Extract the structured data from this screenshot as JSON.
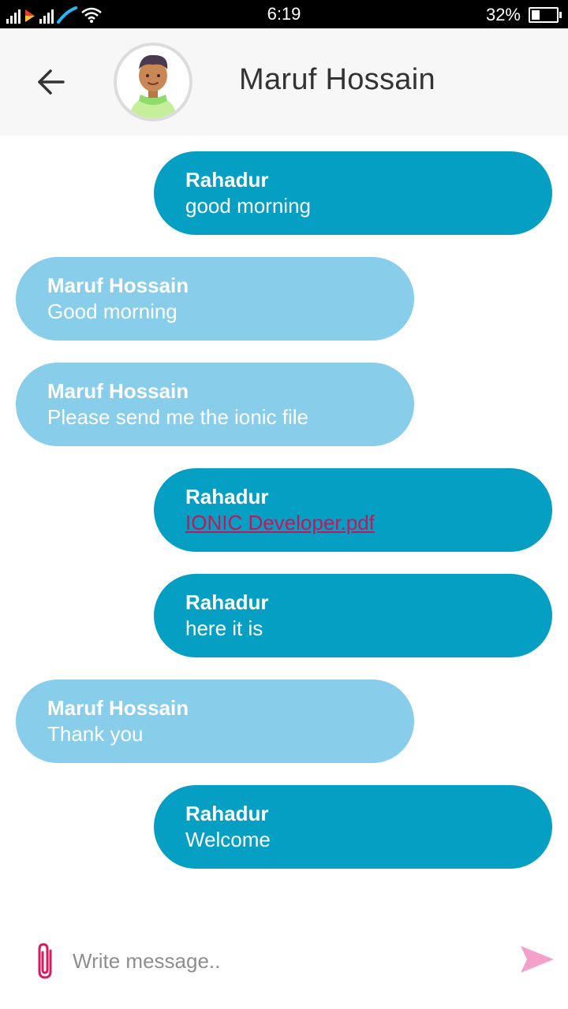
{
  "status_bar": {
    "time": "6:19",
    "battery_percent": "32%",
    "battery_level": 0.32
  },
  "header": {
    "title": "Maruf Hossain",
    "back_icon": "arrow-left-icon",
    "avatar_icon": "user-avatar"
  },
  "messages": [
    {
      "side": "me",
      "sender": "Rahadur",
      "text": "good morning",
      "is_link": false
    },
    {
      "side": "them",
      "sender": "Maruf Hossain",
      "text": "Good morning",
      "is_link": false
    },
    {
      "side": "them",
      "sender": "Maruf Hossain",
      "text": "Please send me the ionic file",
      "is_link": false
    },
    {
      "side": "me",
      "sender": "Rahadur",
      "text": "IONIC Developer.pdf",
      "is_link": true
    },
    {
      "side": "me",
      "sender": "Rahadur",
      "text": "here it is",
      "is_link": false
    },
    {
      "side": "them",
      "sender": "Maruf Hossain",
      "text": "Thank you",
      "is_link": false
    },
    {
      "side": "me",
      "sender": "Rahadur",
      "text": "Welcome",
      "is_link": false
    }
  ],
  "composer": {
    "placeholder": "Write message..",
    "value": "",
    "attach_icon": "paperclip-icon",
    "send_icon": "send-icon"
  },
  "colors": {
    "my_bubble": "#059fc3",
    "their_bubble": "#88ceea",
    "link": "#c2185b",
    "attach": "#d81b60",
    "send": "#f3a1c8"
  }
}
